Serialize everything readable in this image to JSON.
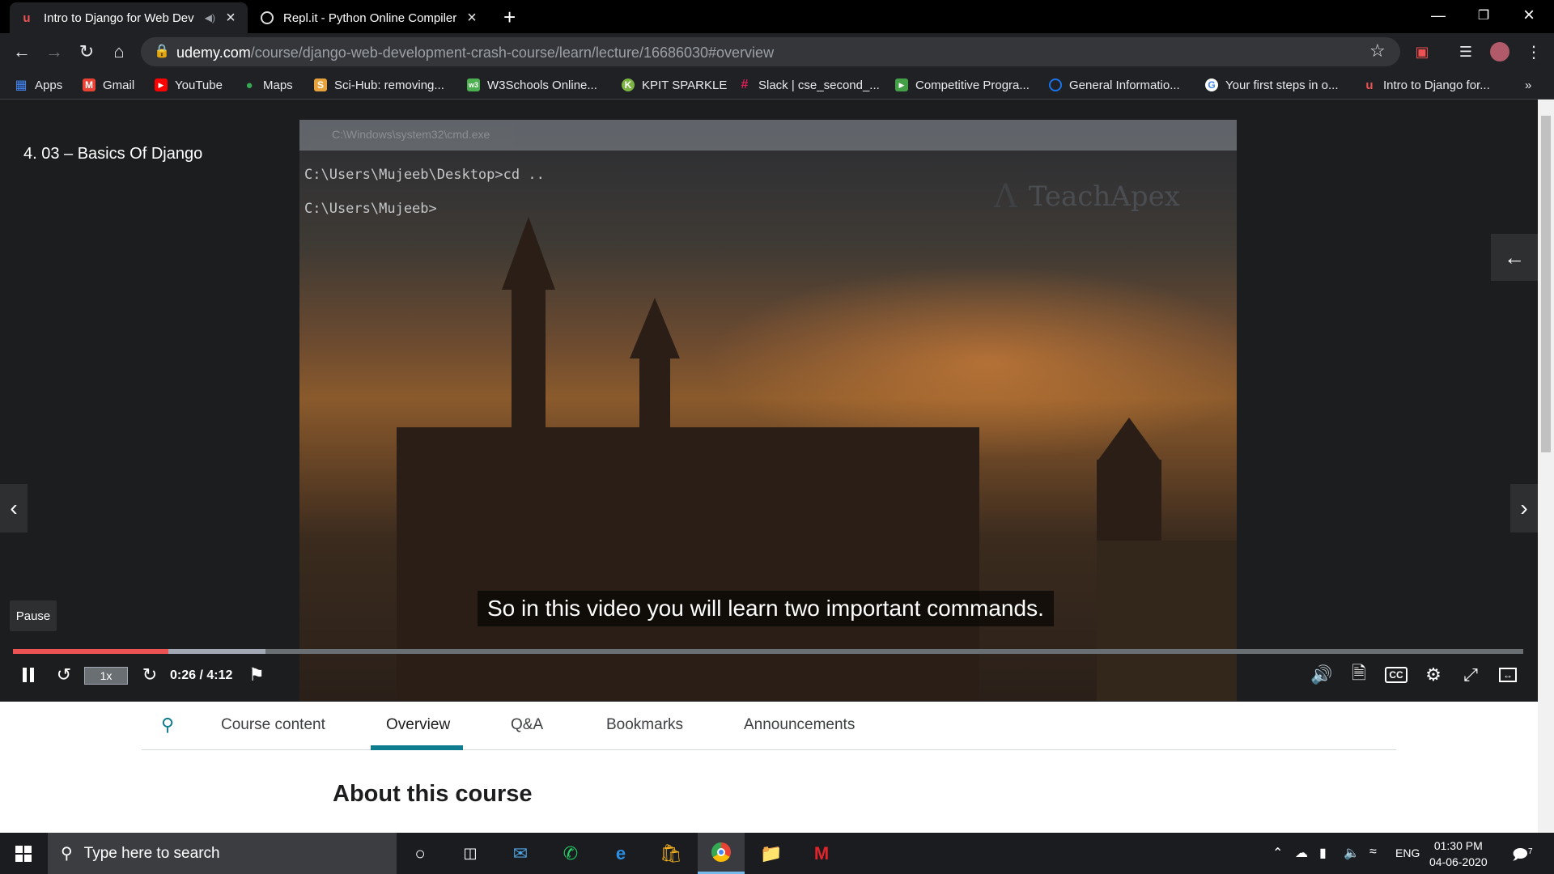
{
  "browser": {
    "tabs": [
      {
        "title": "Intro to Django for Web Dev",
        "favicon": "udemy-icon"
      },
      {
        "title": "Repl.it - Python Online Compiler",
        "favicon": "replit-icon"
      }
    ],
    "new_tab": "+",
    "url_host": "udemy.com",
    "url_path": "/course/django-web-development-crash-course/learn/lecture/16686030#overview",
    "bookmarks": [
      {
        "label": "Apps",
        "icon": "apps-grid-icon",
        "color": "#4285f4"
      },
      {
        "label": "Gmail",
        "icon": "gmail-icon",
        "color": "#ea4335"
      },
      {
        "label": "YouTube",
        "icon": "youtube-icon",
        "color": "#ff0000"
      },
      {
        "label": "Maps",
        "icon": "maps-pin-icon",
        "color": "#34a853"
      },
      {
        "label": "Sci-Hub: removing...",
        "icon": "scihub-icon",
        "color": "#e8a23b"
      },
      {
        "label": "W3Schools Online...",
        "icon": "w3schools-icon",
        "color": "#4caf50"
      },
      {
        "label": "KPIT SPARKLE",
        "icon": "kpit-icon",
        "color": "#7cb342"
      },
      {
        "label": "Slack | cse_second_...",
        "icon": "slack-icon",
        "color": "#e01e5a"
      },
      {
        "label": "Competitive Progra...",
        "icon": "cp-icon",
        "color": "#43a047"
      },
      {
        "label": "General Informatio...",
        "icon": "circle-icon",
        "color": "#1a73e8"
      },
      {
        "label": "Your first steps in o...",
        "icon": "google-icon",
        "color": "#ffffff"
      },
      {
        "label": "Intro to Django for...",
        "icon": "udemy-icon",
        "color": "#ec5252"
      }
    ],
    "more": "»"
  },
  "player": {
    "lecture_title": "4. 03 – Basics Of Django",
    "window_caption": "C:\\Windows\\system32\\cmd.exe",
    "cmd_lines": [
      "C:\\Users\\Mujeeb\\Desktop>cd ..",
      "C:\\Users\\Mujeeb>"
    ],
    "watermark": "TeachApex",
    "subtitle": "So in this video you will learn two important commands.",
    "tooltip": "Pause",
    "speed": "1x",
    "time": "0:26 / 4:12",
    "progress_played": 0.103,
    "progress_buffered": 0.167,
    "accent": "#ec5252"
  },
  "course_tabs": [
    {
      "label": "Course content"
    },
    {
      "label": "Overview"
    },
    {
      "label": "Q&A"
    },
    {
      "label": "Bookmarks"
    },
    {
      "label": "Announcements"
    }
  ],
  "about_heading": "About this course",
  "taskbar": {
    "search_placeholder": "Type here to search",
    "lang": "ENG",
    "time": "01:30 PM",
    "date": "04-06-2020",
    "notifications": "7"
  }
}
